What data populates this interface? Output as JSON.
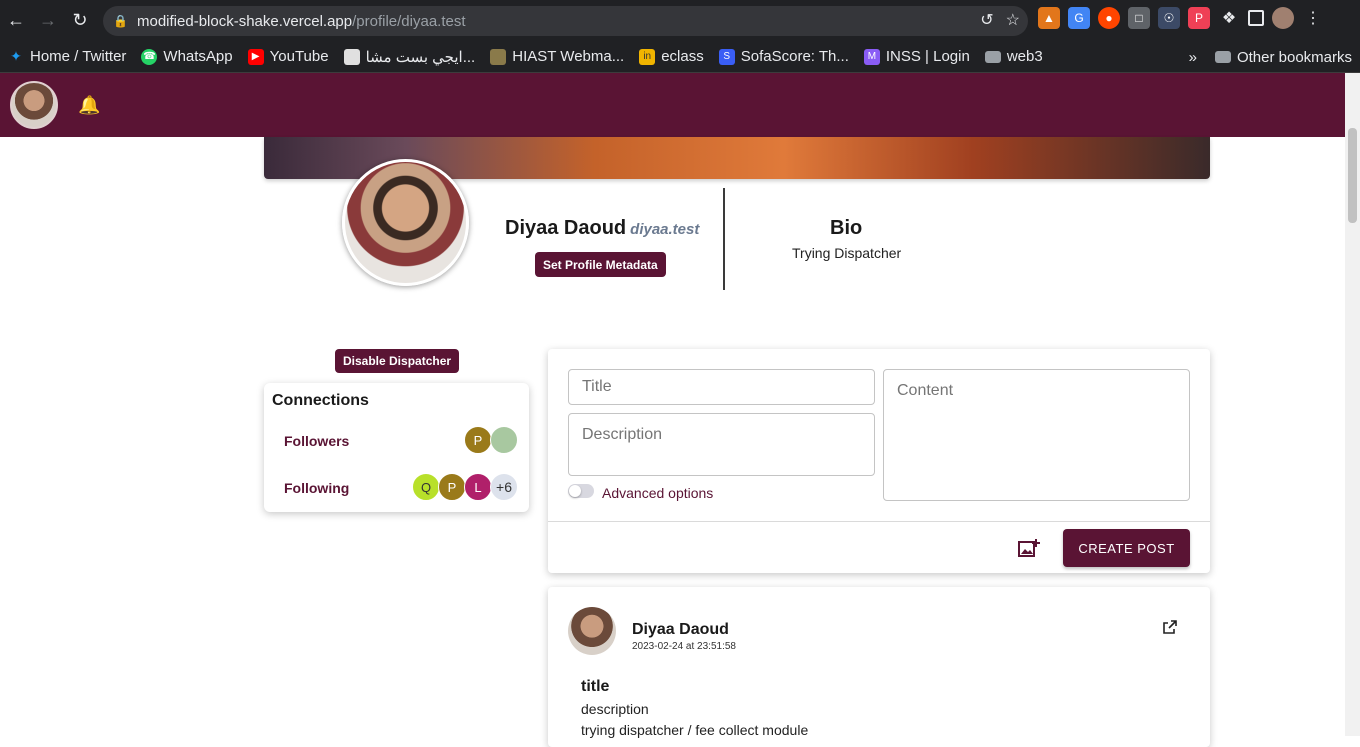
{
  "browser": {
    "url_host": "modified-block-shake.vercel.app",
    "url_path": "/profile/diyaa.test",
    "bookmarks": [
      {
        "label": "Home / Twitter",
        "icon": "twitter-icon",
        "color": "#1d9bf0"
      },
      {
        "label": "WhatsApp",
        "icon": "whatsapp-icon",
        "color": "#25d366"
      },
      {
        "label": "YouTube",
        "icon": "youtube-icon",
        "color": "#ff0000"
      },
      {
        "label": "ايجي بست مشا...",
        "icon": "egybest-icon",
        "color": "#e0e0e0"
      },
      {
        "label": "HIAST Webma...",
        "icon": "hiast-icon",
        "color": "#8a7a4a"
      },
      {
        "label": "eclass",
        "icon": "eclass-icon",
        "color": "#f0b400"
      },
      {
        "label": "SofaScore: Th...",
        "icon": "sofascore-icon",
        "color": "#3a5ef5"
      },
      {
        "label": "INSS | Login",
        "icon": "inss-icon",
        "color": "#8a5cf5"
      },
      {
        "label": "web3",
        "icon": "folder-icon",
        "color": "#9aa0a6"
      }
    ],
    "more_label": "»",
    "other_bookmarks": "Other bookmarks"
  },
  "profile": {
    "name": "Diyaa Daoud",
    "handle": "diyaa.test",
    "set_metadata_label": "Set Profile Metadata",
    "bio_title": "Bio",
    "bio_text": "Trying Dispatcher",
    "disable_dispatcher_label": "Disable Dispatcher"
  },
  "connections": {
    "title": "Connections",
    "followers_label": "Followers",
    "following_label": "Following",
    "followers": [
      {
        "initial": "P",
        "color": "#9a7a1a"
      },
      {
        "initial": "",
        "color": "#a8c8a0"
      }
    ],
    "following": [
      {
        "initial": "Q",
        "color": "#b8e02a",
        "text_color": "#333"
      },
      {
        "initial": "P",
        "color": "#9a7a1a",
        "text_color": "#fff"
      },
      {
        "initial": "L",
        "color": "#b0206a",
        "text_color": "#fff"
      },
      {
        "initial": "+6",
        "color": "#dde2ec",
        "text_color": "#333"
      }
    ]
  },
  "composer": {
    "title_placeholder": "Title",
    "description_placeholder": "Description",
    "content_placeholder": "Content",
    "advanced_label": "Advanced options",
    "create_label": "CREATE POST"
  },
  "post": {
    "author": "Diyaa Daoud",
    "date": "2023-02-24 at 23:51:58",
    "title": "title",
    "description": "description",
    "content": "trying dispatcher / fee collect module"
  },
  "colors": {
    "brand": "#5a1434"
  }
}
